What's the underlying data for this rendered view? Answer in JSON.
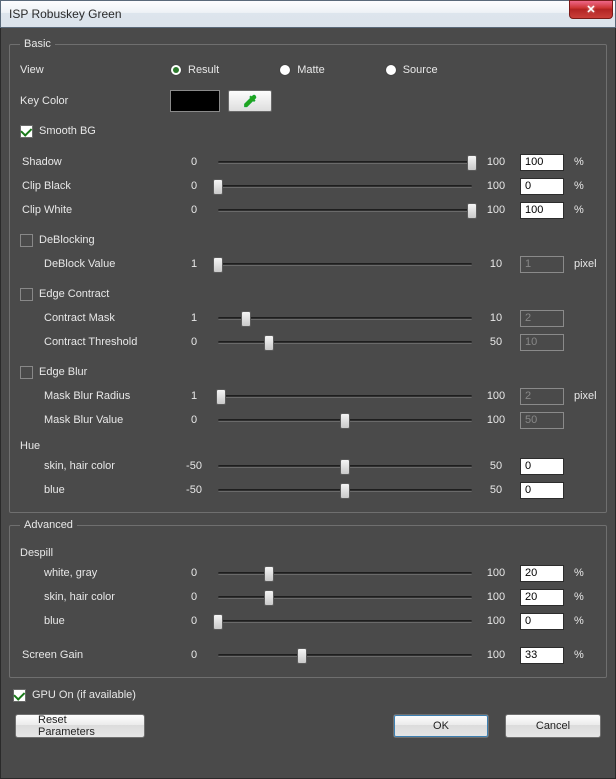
{
  "window": {
    "title": "ISP Robuskey Green"
  },
  "basic": {
    "legend": "Basic",
    "view": {
      "label": "View",
      "options": [
        "Result",
        "Matte",
        "Source"
      ],
      "selected": "Result"
    },
    "keycolor": {
      "label": "Key Color",
      "swatch_hex": "#000000"
    },
    "smooth_bg": {
      "label": "Smooth BG",
      "checked": true
    },
    "shadow": {
      "label": "Shadow",
      "min": 0,
      "max": 100,
      "value": 100,
      "unit": "%"
    },
    "clip_black": {
      "label": "Clip Black",
      "min": 0,
      "max": 100,
      "value": 0,
      "unit": "%"
    },
    "clip_white": {
      "label": "Clip White",
      "min": 0,
      "max": 100,
      "value": 100,
      "unit": "%"
    },
    "deblocking": {
      "label": "DeBlocking",
      "checked": false,
      "deblock_value": {
        "label": "DeBlock Value",
        "min": 1,
        "max": 10,
        "value": 1,
        "unit": "pixel"
      }
    },
    "edge_contract": {
      "label": "Edge Contract",
      "checked": false,
      "contract_mask": {
        "label": "Contract Mask",
        "min": 1,
        "max": 10,
        "value": 2
      },
      "contract_threshold": {
        "label": "Contract Threshold",
        "min": 0,
        "max": 50,
        "value": 10
      }
    },
    "edge_blur": {
      "label": "Edge Blur",
      "checked": false,
      "mask_blur_radius": {
        "label": "Mask Blur Radius",
        "min": 1,
        "max": 100,
        "value": 2,
        "unit": "pixel"
      },
      "mask_blur_value": {
        "label": "Mask Blur Value",
        "min": 0,
        "max": 100,
        "value": 50
      }
    },
    "hue": {
      "label": "Hue",
      "skin": {
        "label": "skin, hair color",
        "min": -50,
        "max": 50,
        "value": 0
      },
      "blue": {
        "label": "blue",
        "min": -50,
        "max": 50,
        "value": 0
      }
    }
  },
  "advanced": {
    "legend": "Advanced",
    "despill": {
      "label": "Despill",
      "white": {
        "label": "white, gray",
        "min": 0,
        "max": 100,
        "value": 20,
        "unit": "%"
      },
      "skin": {
        "label": "skin, hair color",
        "min": 0,
        "max": 100,
        "value": 20,
        "unit": "%"
      },
      "blue": {
        "label": "blue",
        "min": 0,
        "max": 100,
        "value": 0,
        "unit": "%"
      }
    },
    "screen_gain": {
      "label": "Screen Gain",
      "min": 0,
      "max": 100,
      "value": 33,
      "unit": "%"
    }
  },
  "gpu": {
    "label": "GPU On (if available)",
    "checked": true
  },
  "buttons": {
    "reset": "Reset Parameters",
    "ok": "OK",
    "cancel": "Cancel"
  }
}
